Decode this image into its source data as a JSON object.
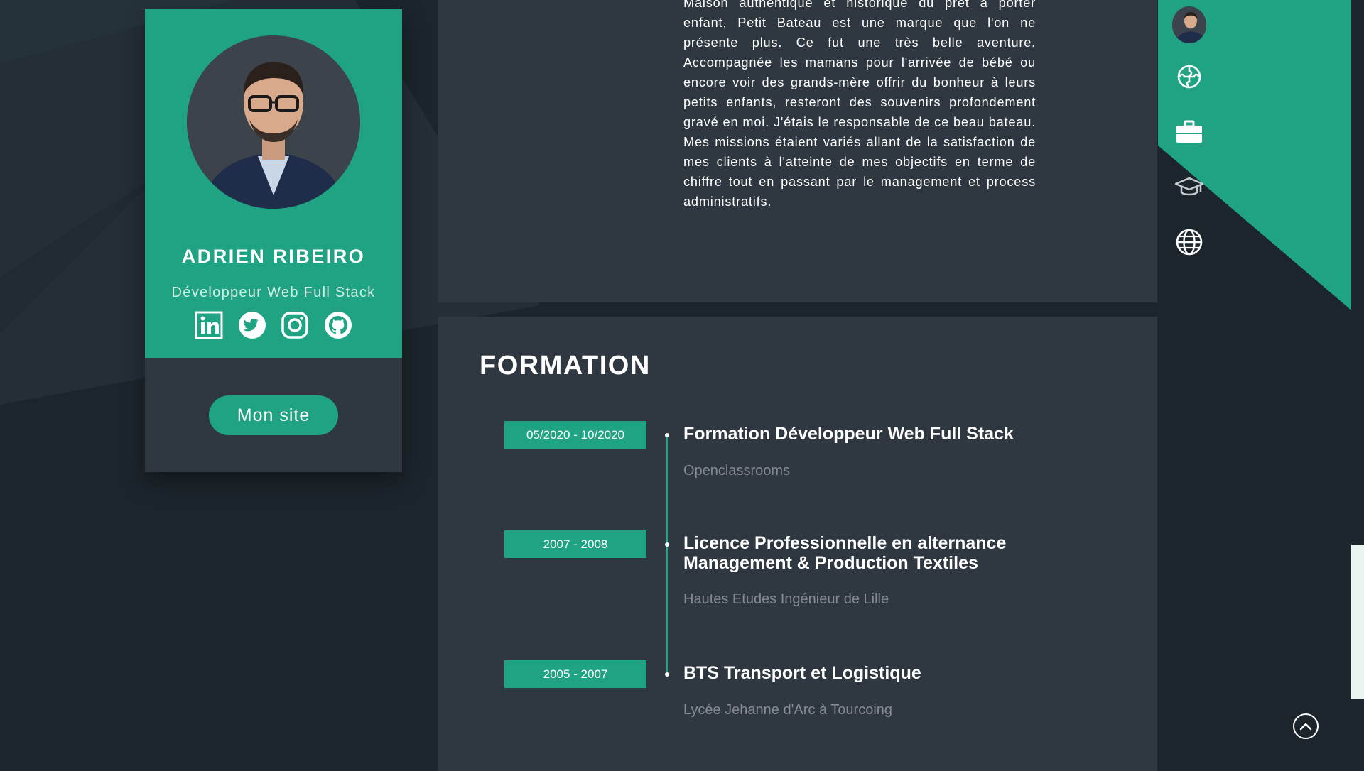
{
  "profile": {
    "name": "ADRIEN RIBEIRO",
    "role": "Développeur Web Full Stack",
    "socials": [
      {
        "icon": "linkedin-icon"
      },
      {
        "icon": "twitter-icon"
      },
      {
        "icon": "instagram-icon"
      },
      {
        "icon": "github-icon"
      }
    ],
    "site_button_label": "Mon site"
  },
  "about": {
    "text": "Maison authentique et historique du prêt à porter enfant, Petit Bateau est une marque que l'on ne présente plus. Ce fut une très belle aventure. Accompagnée les mamans pour l'arrivée de bébé ou encore voir des grands-mère offrir du bonheur à leurs petits enfants, resteront des souvenirs profondement gravé en moi. J'étais le responsable de ce beau bateau. Mes missions étaient variés allant de la satisfaction de mes clients à l'atteinte de mes objectifs en terme de chiffre tout en passant par le management et process administratifs."
  },
  "formation": {
    "title": "FORMATION",
    "entries": [
      {
        "date": "05/2020 - 10/2020",
        "title": "Formation Développeur Web Full Stack",
        "school": "Openclassrooms"
      },
      {
        "date": "2007 - 2008",
        "title": "Licence Professionnelle en alternance Management & Production Textiles",
        "school": "Hautes Etudes Ingénieur de Lille"
      },
      {
        "date": "2005 - 2007",
        "title": "BTS Transport et Logistique",
        "school": "Lycée Jehanne d'Arc à Tourcoing"
      }
    ]
  },
  "nav": {
    "items": [
      "avatar",
      "puzzle-icon",
      "briefcase-icon",
      "graduation-cap-icon",
      "globe-icon"
    ]
  },
  "colors": {
    "accent": "#1fa383",
    "panel": "#2f3740",
    "background": "#1c252c",
    "muted_text": "#858c93"
  }
}
